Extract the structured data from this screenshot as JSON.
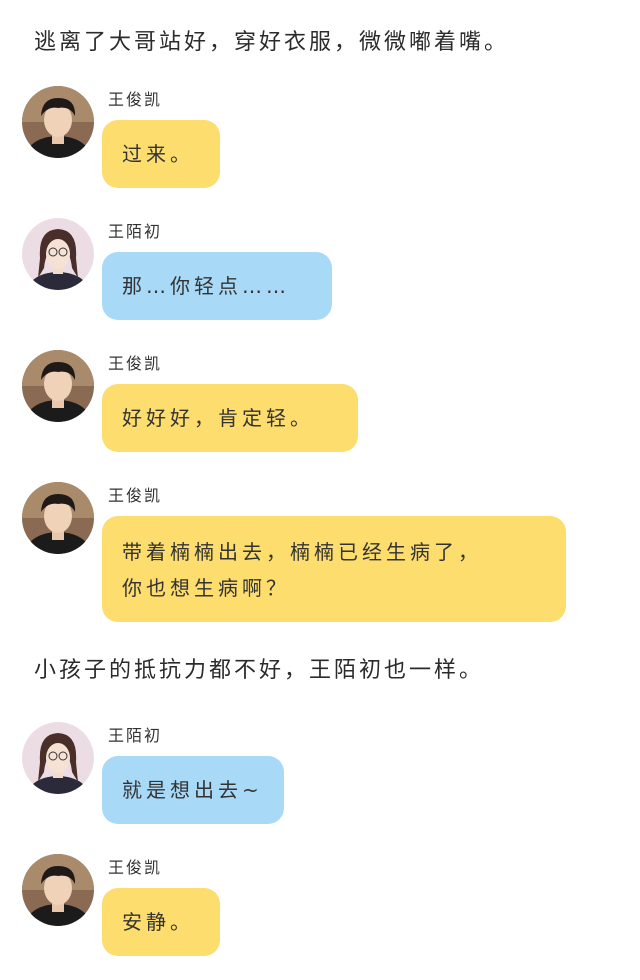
{
  "narration": [
    "逃离了大哥站好，穿好衣服，微微嘟着嘴。",
    "小孩子的抵抗力都不好，王陌初也一样。"
  ],
  "messages": [
    {
      "sender": "王俊凯",
      "avatar": "boy-avatar",
      "bubble_color": "#fcdd6e",
      "lines": [
        "过来。"
      ]
    },
    {
      "sender": "王陌初",
      "avatar": "girl-avatar",
      "bubble_color": "#a8daf8",
      "lines": [
        "那…你轻点……"
      ]
    },
    {
      "sender": "王俊凯",
      "avatar": "boy-avatar",
      "bubble_color": "#fcdd6e",
      "lines": [
        "好好好，肯定轻。"
      ]
    },
    {
      "sender": "王俊凯",
      "avatar": "boy-avatar",
      "bubble_color": "#fcdd6e",
      "lines": [
        "带着楠楠出去，楠楠已经生病了，",
        "你也想生病啊？"
      ]
    },
    {
      "sender": "王陌初",
      "avatar": "girl-avatar",
      "bubble_color": "#a8daf8",
      "lines": [
        "就是想出去~"
      ]
    },
    {
      "sender": "王俊凯",
      "avatar": "boy-avatar",
      "bubble_color": "#fcdd6e",
      "lines": [
        "安静。"
      ]
    }
  ]
}
